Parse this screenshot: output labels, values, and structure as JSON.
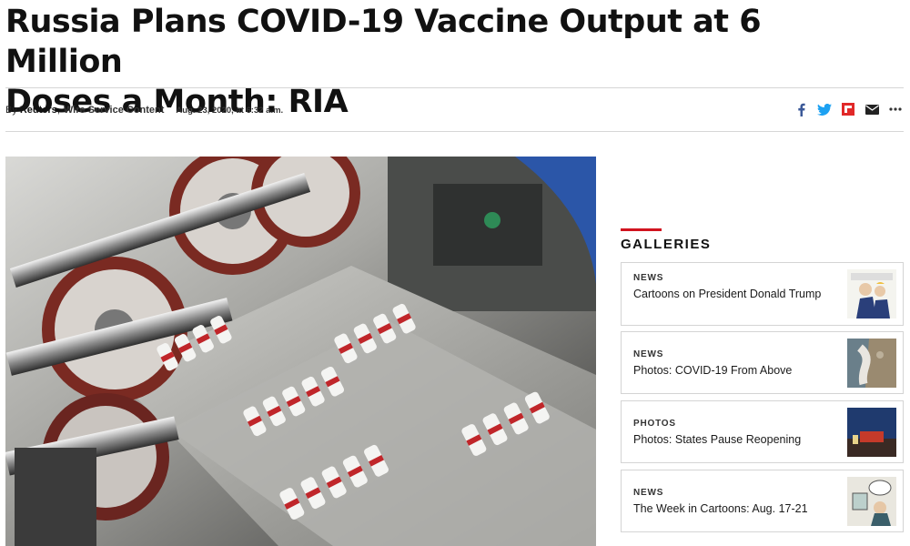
{
  "article": {
    "headline_line1": "Russia Plans COVID-19 Vaccine Output at 6 Million",
    "headline_line2": "Doses a Month: RIA",
    "byline": {
      "by": "By",
      "author": "Reuters",
      "separator": ",",
      "organization": "Wire Service Content",
      "date": "Aug. 23, 2020, at 6:32 a.m."
    }
  },
  "share_icons": [
    "facebook-icon",
    "twitter-icon",
    "flipboard-icon",
    "email-icon",
    "more-icon"
  ],
  "colors": {
    "accent_red": "#d1131f",
    "facebook": "#3b5998",
    "twitter": "#1da1f2",
    "flipboard": "#e12828"
  },
  "galleries": {
    "heading": "GALLERIES",
    "items": [
      {
        "kicker": "NEWS",
        "title": "Cartoons on President Donald Trump"
      },
      {
        "kicker": "NEWS",
        "title": "Photos: COVID-19 From Above"
      },
      {
        "kicker": "PHOTOS",
        "title": "Photos: States Pause Reopening"
      },
      {
        "kicker": "NEWS",
        "title": "The Week in Cartoons: Aug. 17-21"
      }
    ]
  }
}
